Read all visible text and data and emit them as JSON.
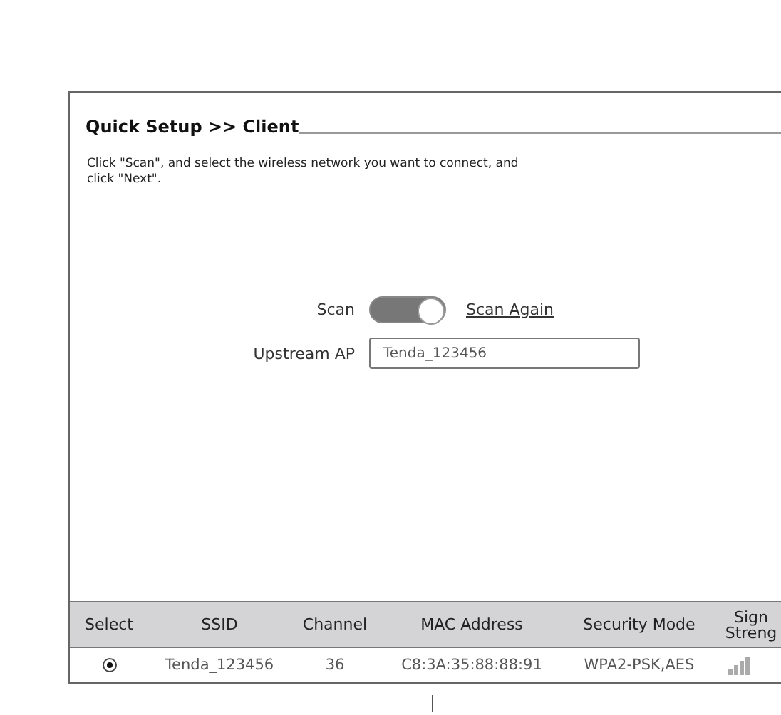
{
  "panel": {
    "title_prefix": "Quick Setup >> ",
    "title": "Client",
    "description": "Click \"Scan\", and select the wireless network you want to connect, and click \"Next\".",
    "scan": {
      "label": "Scan",
      "on": true,
      "link": "Scan Again"
    },
    "upstream_ap": {
      "label": "Upstream AP",
      "value": "Tenda_123456"
    },
    "table": {
      "columns": [
        "Select",
        "SSID",
        "Channel",
        "MAC Address",
        "Security Mode",
        "Sign Streng"
      ],
      "rows": [
        {
          "selected": true,
          "ssid": "Tenda_123456",
          "channel": "36",
          "mac": "C8:3A:35:88:88:91",
          "security": "WPA2-PSK,AES"
        }
      ]
    }
  }
}
